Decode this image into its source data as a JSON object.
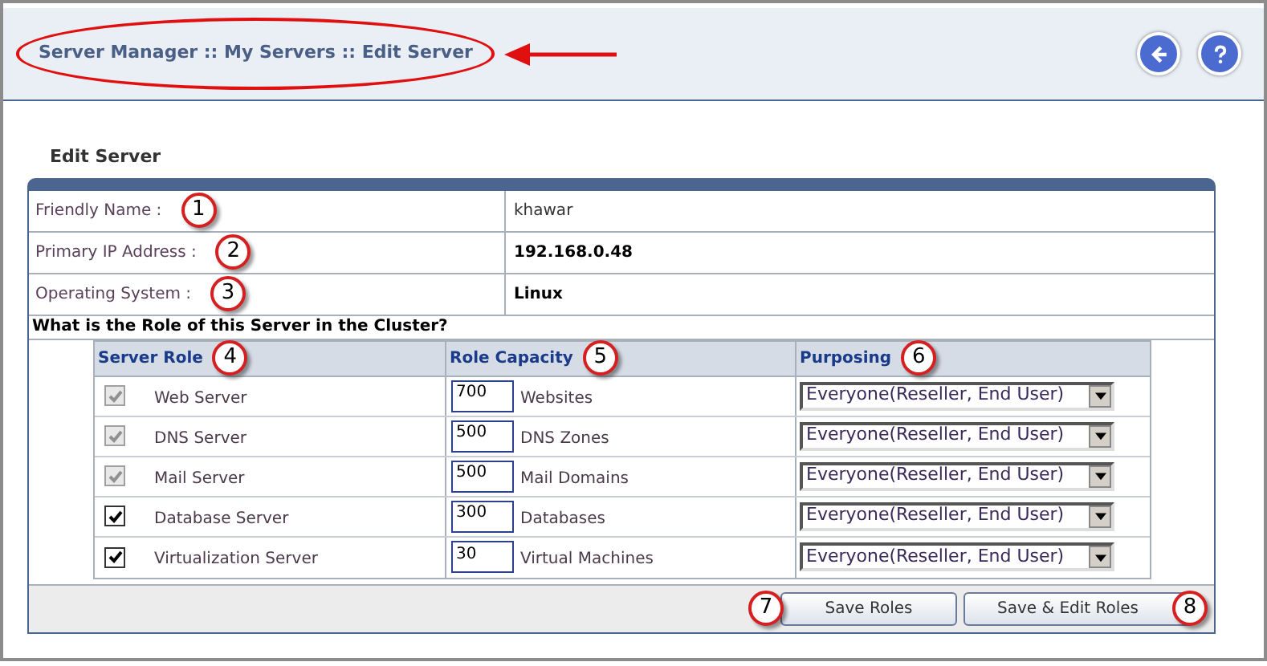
{
  "header": {
    "breadcrumb": "Server Manager :: My Servers :: Edit Server",
    "highlighted": true
  },
  "section_title": "Edit Server",
  "fields": [
    {
      "label": "Friendly Name :",
      "value": "khawar",
      "bold": false,
      "callout": "1"
    },
    {
      "label": "Primary IP Address :",
      "value": "192.168.0.48",
      "bold": true,
      "callout": "2"
    },
    {
      "label": "Operating System :",
      "value": "Linux",
      "bold": true,
      "callout": "3"
    }
  ],
  "question": "What is the Role of this Server in the Cluster?",
  "roles_table": {
    "columns": [
      {
        "label": "Server Role",
        "callout": "4"
      },
      {
        "label": "Role Capacity",
        "callout": "5"
      },
      {
        "label": "Purposing",
        "callout": "6"
      }
    ],
    "rows": [
      {
        "role": "Web Server",
        "checked": true,
        "disabled": true,
        "capacity": "700",
        "unit": "Websites",
        "purposing": "Everyone(Reseller, End User)"
      },
      {
        "role": "DNS Server",
        "checked": true,
        "disabled": true,
        "capacity": "500",
        "unit": "DNS Zones",
        "purposing": "Everyone(Reseller, End User)"
      },
      {
        "role": "Mail Server",
        "checked": true,
        "disabled": true,
        "capacity": "500",
        "unit": "Mail Domains",
        "purposing": "Everyone(Reseller, End User)"
      },
      {
        "role": "Database Server",
        "checked": true,
        "disabled": false,
        "capacity": "300",
        "unit": "Databases",
        "purposing": "Everyone(Reseller, End User)"
      },
      {
        "role": "Virtualization Server",
        "checked": true,
        "disabled": false,
        "capacity": "30",
        "unit": "Virtual Machines",
        "purposing": "Everyone(Reseller, End User)"
      }
    ]
  },
  "buttons": [
    {
      "label": "Save Roles",
      "callout": "7"
    },
    {
      "label": "Save & Edit Roles",
      "callout": "8"
    }
  ]
}
